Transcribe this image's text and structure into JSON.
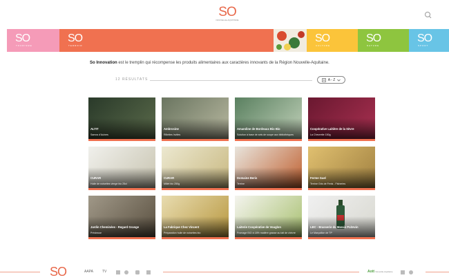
{
  "header": {
    "logo_text": "SO",
    "logo_sub": "NOUVELLE-AQUITAINE",
    "search_icon": "search-icon"
  },
  "band": {
    "segments": [
      {
        "text": "SO",
        "sub": "TOURISME",
        "color": "#f59bb8"
      },
      {
        "text": "SO",
        "sub": "TERROIR",
        "color": "#f07150"
      },
      {
        "text": "",
        "sub": "",
        "color": "#f1ece0"
      },
      {
        "text": "SO",
        "sub": "CULTURE",
        "color": "#fbc43a"
      },
      {
        "text": "SO",
        "sub": "NATURE",
        "color": "#8ec53f"
      },
      {
        "text": "SO",
        "sub": "SPORT",
        "color": "#68c4e6"
      }
    ]
  },
  "intro": {
    "brand": "So Innovation",
    "text": " est le tremplin qui récompense les produits alimentaires aux caractères innovants de la Région Nouvelle-Aquitaine."
  },
  "filter": {
    "count_label": "12 RÉSULTATS",
    "sort_label": "A - Z"
  },
  "products": [
    {
      "title": "ALTIT",
      "desc": "Samos d'Aulnes",
      "bg": "#3e4a3a"
    },
    {
      "title": "Ambrosine",
      "desc": "Rillettes Invites",
      "bg": "#8a8f78"
    },
    {
      "title": "Amandine de Bordeaux Bio Bio",
      "desc": "Solution à base de sels de soupe aux bibliothèques",
      "bg": "#6b7d70"
    },
    {
      "title": "Coopérative Laitière de la Sèvre",
      "desc": "La Chevrette 150g",
      "bg": "#8b2140"
    },
    {
      "title": "CURAR",
      "desc": "Huile de noisettes vierge bio 25cl",
      "bg": "#dcdcd8"
    },
    {
      "title": "CURAR",
      "desc": "Millet bio 250g",
      "bg": "#d8d0a8"
    },
    {
      "title": "Domaine Beris",
      "desc": "Terrine",
      "bg": "#b0a070"
    },
    {
      "title": "Ferme Gael",
      "desc": "Terrine Gris de Fenis - Fisheries",
      "bg": "#c8a85a"
    },
    {
      "title": "Jardin Cheminées - Regard Grange",
      "desc": "Précieuse",
      "bg": "#7a6e5e"
    },
    {
      "title": "La Fabrique Chez Vincent",
      "desc": "Préparation huile de noisettes bio",
      "bg": "#c8b060"
    },
    {
      "title": "Laiterie Coopérative de Vouglon",
      "desc": "Fromage BIO à 18% matière grasse au lait de chèvre",
      "bg": "#e4e8dc"
    },
    {
      "title": "LBC - Brasserie du Marais Poitevin",
      "desc": "Le Marçaillon de TP",
      "bg": "#2e5a3a"
    }
  ],
  "footer": {
    "logo": "SO",
    "partner1": "AAPA",
    "partner2": "TV",
    "right_brand": "Aott",
    "right_sub": "Nouvelle-Aquitaine"
  }
}
